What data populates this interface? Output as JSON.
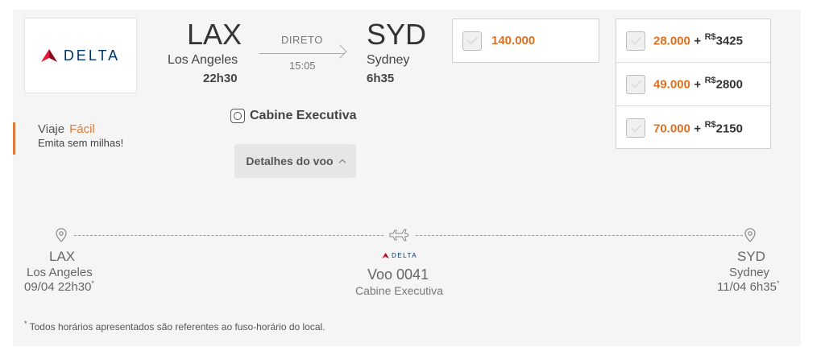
{
  "airline": {
    "name": "DELTA",
    "brand_color": "#c8102e",
    "text_color": "#003366"
  },
  "flight": {
    "origin": {
      "code": "LAX",
      "city": "Los Angeles",
      "time": "22h30"
    },
    "route_type": "DIRETO",
    "duration": "15:05",
    "destination": {
      "code": "SYD",
      "city": "Sydney",
      "time": "6h35"
    },
    "cabin": "Cabine Executiva",
    "details_button": "Detalhes do voo"
  },
  "promo": {
    "title_prefix": "Viaje",
    "title_highlight": "Fácil",
    "subtitle": "Emita sem milhas!"
  },
  "prices": {
    "miles_only": "140.000",
    "combos": [
      {
        "miles": "28.000",
        "plus": "+",
        "currency": "R$",
        "money": "3425"
      },
      {
        "miles": "49.000",
        "plus": "+",
        "currency": "R$",
        "money": "2800"
      },
      {
        "miles": "70.000",
        "plus": "+",
        "currency": "R$",
        "money": "2150"
      }
    ],
    "accent_color": "#e07020"
  },
  "segment": {
    "from": {
      "code": "LAX",
      "city": "Los Angeles",
      "datetime": "09/04 22h30",
      "mark": "*"
    },
    "airline": "DELTA",
    "flight_number": "Voo 0041",
    "cabin": "Cabine Executiva",
    "to": {
      "code": "SYD",
      "city": "Sydney",
      "datetime": "11/04 6h35",
      "mark": "*"
    }
  },
  "footnote": {
    "mark": "*",
    "text": " Todos horários apresentados são referentes ao fuso-horário do local."
  },
  "icons": [
    "delta-logo-icon",
    "arrow-right-icon",
    "cabin-seat-icon",
    "chevron-up-icon",
    "checkbox-icon",
    "location-pin-icon",
    "airplane-icon"
  ]
}
